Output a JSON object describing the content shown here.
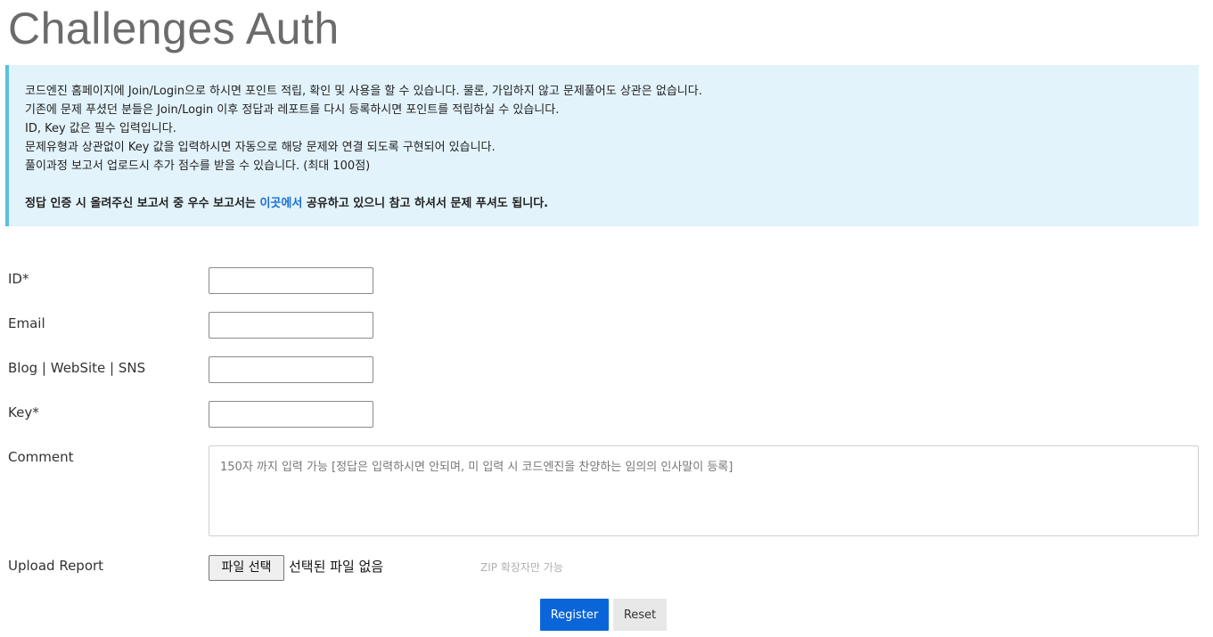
{
  "page": {
    "title": "Challenges Auth"
  },
  "notice": {
    "lines": [
      "코드엔진 홈페이지에 Join/Login으로 하시면 포인트 적립, 확인 및 사용을 할 수 있습니다. 물론, 가입하지 않고 문제풀어도 상관은 없습니다.",
      "기존에 문제 푸셨던 분들은 Join/Login 이후 정답과 레포트를 다시 등록하시면 포인트를 적립하실 수 있습니다.",
      "ID, Key 값은 필수 입력입니다.",
      "문제유형과 상관없이 Key 값을 입력하시면 자동으로 해당 문제와 연결 되도록 구현되어 있습니다.",
      "풀이과정 보고서 업로드시 추가 점수를 받을 수 있습니다. (최대 100점)"
    ],
    "bold_prefix": "정답 인증 시 올려주신 보고서 중 우수 보고서는 ",
    "bold_link": "이곳에서",
    "bold_suffix": " 공유하고 있으니 참고 하셔서 문제 푸셔도 됩니다."
  },
  "form": {
    "id_label": "ID*",
    "id_value": "",
    "email_label": "Email",
    "email_value": "",
    "blog_label": "Blog | WebSite | SNS",
    "blog_value": "",
    "key_label": "Key*",
    "key_value": "",
    "comment_label": "Comment",
    "comment_placeholder": "150자 까지 입력 가능 [정답은 입력하시면 안되며, 미 입력 시 코드엔진을 찬양하는 임의의 인사말이 등록]",
    "upload_label": "Upload Report",
    "file_button_label": "파일 선택",
    "file_status": "선택된 파일 없음",
    "file_hint": "ZIP 확장자만 가능"
  },
  "actions": {
    "register_label": "Register",
    "reset_label": "Reset"
  },
  "colors": {
    "primary": "#0a66d8",
    "notice_bg": "#e3f3fb",
    "notice_border": "#5bc0de",
    "link": "#1a6fd1"
  }
}
